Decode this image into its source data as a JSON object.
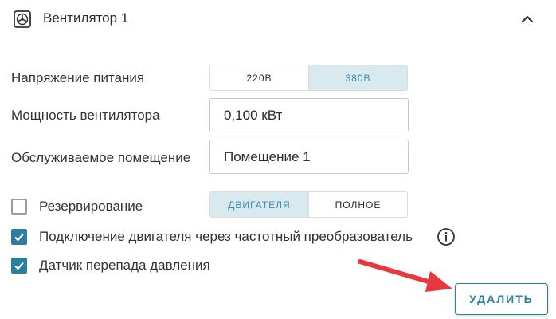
{
  "header": {
    "title": "Вентилятор 1",
    "icon": "fan-icon",
    "collapse_icon": "chevron-up-icon"
  },
  "voltage": {
    "label": "Напряжение питания",
    "options": [
      "220В",
      "380В"
    ],
    "selected": "380В"
  },
  "power": {
    "label": "Мощность вентилятора",
    "value": "0,100 кВт"
  },
  "room": {
    "label": "Обслуживаемое помещение",
    "value": "Помещение 1"
  },
  "reserve": {
    "label": "Резервирование",
    "checked": false,
    "options": [
      "ДВИГАТЕЛЯ",
      "ПОЛНОЕ"
    ],
    "selected": "ДВИГАТЕЛЯ"
  },
  "vfd": {
    "label": "Подключение двигателя через частотный преобразователь",
    "checked": true,
    "info_icon": "info-icon"
  },
  "pressure_sensor": {
    "label": "Датчик перепада давления",
    "checked": true
  },
  "actions": {
    "delete_label": "УДАЛИТЬ"
  },
  "colors": {
    "accent": "#2c7e9f",
    "active_segment_bg": "#d8eaf0",
    "active_segment_text": "#3a8fb0",
    "annotation_arrow": "#e8383d"
  }
}
